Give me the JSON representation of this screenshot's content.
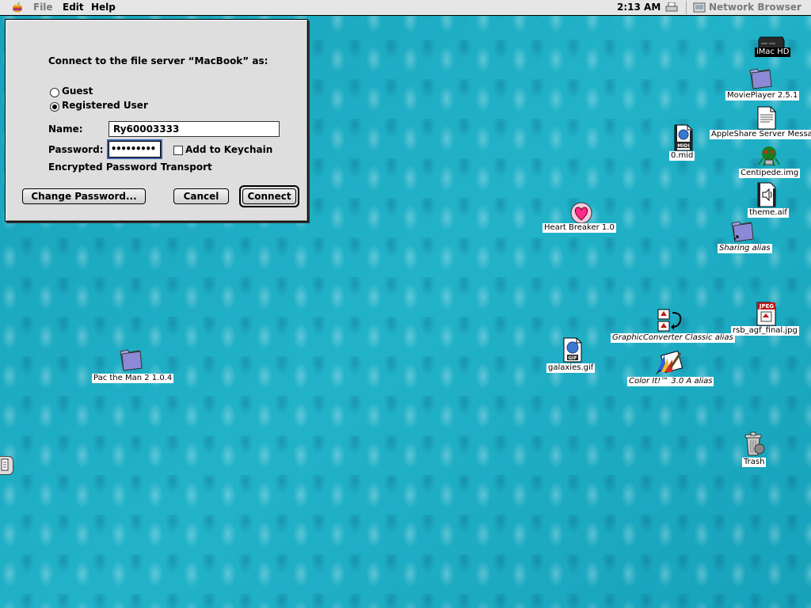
{
  "menubar": {
    "menus": [
      "File",
      "Edit",
      "Help"
    ],
    "clock": "2:13 AM",
    "app_name": "Network Browser"
  },
  "dialog": {
    "prompt": "Connect to the file server “MacBook” as:",
    "guest_label": "Guest",
    "registered_label": "Registered User",
    "selected_option": "Registered User",
    "name_label": "Name:",
    "name_value": "Ry60003333",
    "password_label": "Password:",
    "password_value": "•••••••••",
    "keychain_label": "Add to Keychain",
    "keychain_checked": false,
    "encrypted_label": "Encrypted Password Transport",
    "change_password_label": "Change Password...",
    "cancel_label": "Cancel",
    "connect_label": "Connect"
  },
  "desktop": {
    "icons": {
      "imac_hd": "iMac HD",
      "movieplayer": "MoviePlayer 2.5.1",
      "appleshare": "AppleShare Server Messa",
      "mid": "0.mid",
      "centipede": "Centipede.img",
      "theme": "theme.aif",
      "heartbreaker": "Heart Breaker 1.0",
      "sharing": "Sharing alias",
      "rsb": "rsb_agf_final.jpg",
      "graphicconverter": "GraphicConverter Classic alias",
      "galaxies": "galaxies.gif",
      "colorit": "Color It!™ 3.0 A alias",
      "pacman": "Pac the Man 2 1.0.4",
      "trash": "Trash"
    },
    "badges": {
      "midi": "MIDI",
      "gif": "GIF",
      "jpeg": "JPEG"
    }
  }
}
